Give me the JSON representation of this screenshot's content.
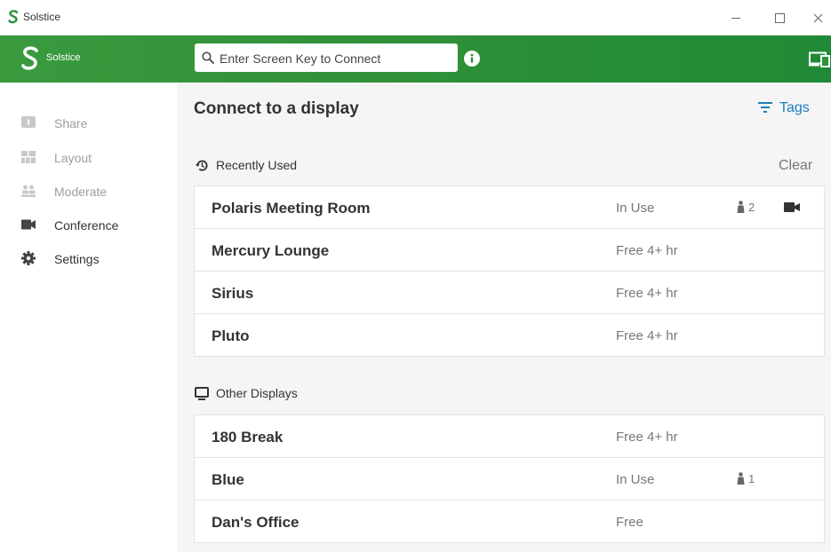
{
  "window": {
    "title": "Solstice"
  },
  "header": {
    "brand": "Solstice",
    "search_placeholder": "Enter Screen Key to Connect"
  },
  "sidebar": {
    "items": [
      {
        "label": "Share",
        "icon": "share-icon",
        "enabled": false
      },
      {
        "label": "Layout",
        "icon": "layout-icon",
        "enabled": false
      },
      {
        "label": "Moderate",
        "icon": "moderate-icon",
        "enabled": false
      },
      {
        "label": "Conference",
        "icon": "camera-icon",
        "enabled": true
      },
      {
        "label": "Settings",
        "icon": "gear-icon",
        "enabled": true
      }
    ]
  },
  "main": {
    "title": "Connect to a display",
    "tags_label": "Tags",
    "recent": {
      "heading": "Recently Used",
      "clear_label": "Clear",
      "rows": [
        {
          "name": "Polaris Meeting Room",
          "status": "In Use",
          "users": "2",
          "camera": true
        },
        {
          "name": "Mercury Lounge",
          "status": "Free 4+ hr"
        },
        {
          "name": "Sirius",
          "status": "Free 4+ hr"
        },
        {
          "name": "Pluto",
          "status": "Free 4+ hr"
        }
      ]
    },
    "other": {
      "heading": "Other Displays",
      "rows": [
        {
          "name": "180 Break",
          "status": "Free 4+ hr"
        },
        {
          "name": "Blue",
          "status": "In Use",
          "users": "1"
        },
        {
          "name": "Dan's Office",
          "status": "Free"
        }
      ]
    }
  },
  "colors": {
    "brand_green": "#2f9038",
    "link_blue": "#1f7dbb"
  }
}
